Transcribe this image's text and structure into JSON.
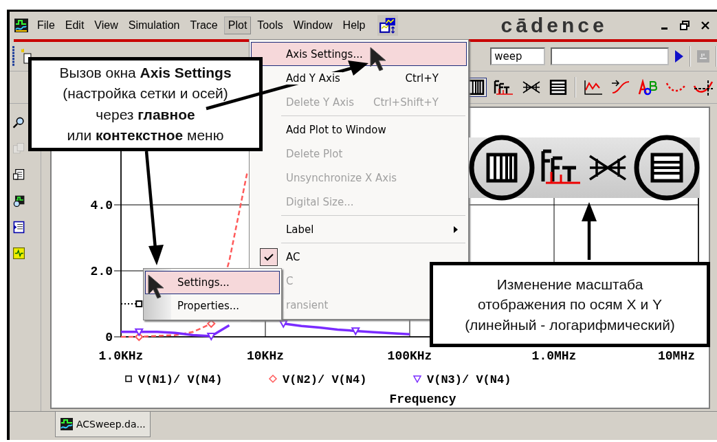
{
  "menu_bar": {
    "items": [
      {
        "label": "File",
        "selected": false
      },
      {
        "label": "Edit",
        "selected": false
      },
      {
        "label": "View",
        "selected": false
      },
      {
        "label": "Simulation",
        "selected": false
      },
      {
        "label": "Trace",
        "selected": false
      },
      {
        "label": "Plot",
        "selected": true
      },
      {
        "label": "Tools",
        "selected": false
      },
      {
        "label": "Window",
        "selected": false
      },
      {
        "label": "Help",
        "selected": false
      }
    ],
    "logo": "cādence"
  },
  "toolbar": {
    "profile_field": "weep"
  },
  "plot_menu": [
    {
      "kind": "item",
      "label": "Axis Settings...",
      "selected": true,
      "disabled": false,
      "checked": false
    },
    {
      "kind": "item",
      "label": "Add Y Axis",
      "shortcut": "Ctrl+Y",
      "selected": false,
      "disabled": false,
      "checked": false
    },
    {
      "kind": "item",
      "label": "Delete Y Axis",
      "shortcut": "Ctrl+Shift+Y",
      "selected": false,
      "disabled": true,
      "checked": false
    },
    {
      "kind": "separator"
    },
    {
      "kind": "item",
      "label": "Add Plot to Window",
      "selected": false,
      "disabled": false,
      "checked": false
    },
    {
      "kind": "item",
      "label": "Delete Plot",
      "selected": false,
      "disabled": true,
      "checked": false
    },
    {
      "kind": "item",
      "label": "Unsynchronize X Axis",
      "selected": false,
      "disabled": true,
      "checked": false
    },
    {
      "kind": "item",
      "label": "Digital Size...",
      "selected": false,
      "disabled": true,
      "checked": false
    },
    {
      "kind": "separator"
    },
    {
      "kind": "submenu",
      "label": "Label",
      "selected": false,
      "disabled": false,
      "checked": false
    },
    {
      "kind": "separator"
    },
    {
      "kind": "item",
      "label": "AC",
      "selected": false,
      "disabled": false,
      "checked": true
    },
    {
      "kind": "item",
      "label": "C",
      "selected": false,
      "disabled": true,
      "checked": false
    },
    {
      "kind": "item",
      "label": "ransient",
      "selected": false,
      "disabled": true,
      "checked": false
    }
  ],
  "context_menu": [
    {
      "label": "Settings...",
      "selected": true
    },
    {
      "label": "Properties...",
      "selected": false
    }
  ],
  "plot": {
    "chart_data": {
      "type": "line",
      "xlabel": "Frequency",
      "categories": [
        "1.0KHz",
        null,
        null,
        null,
        null,
        null,
        null,
        null,
        "10KHz",
        null,
        null,
        null,
        null,
        null,
        null,
        null,
        "100KHz",
        null,
        null,
        null,
        null,
        null,
        null,
        null,
        "1.0MHz",
        null,
        null,
        null,
        null,
        null,
        null,
        null,
        "10MHz"
      ],
      "series": [
        {
          "name": "V(N1)/ V(N4)",
          "color": "#000000",
          "line_style": "dotted",
          "values": [
            1.0,
            1.0,
            null,
            null,
            null,
            null,
            null,
            null,
            null,
            null,
            null,
            null,
            null,
            null,
            null,
            null,
            null,
            null,
            null,
            null,
            null,
            null,
            null,
            null,
            null,
            null,
            null,
            null,
            null,
            null,
            null,
            null,
            null
          ]
        },
        {
          "name": "V(N2)/ V(N4)",
          "color": "#ff5a5a",
          "line_style": "dashed",
          "values": [
            0,
            0,
            0.03,
            0.05,
            0.15,
            0.4,
            2.3,
            5.0,
            null,
            null,
            null,
            null,
            null,
            null,
            null,
            null,
            null,
            null,
            null,
            null,
            null,
            null,
            null,
            null,
            null,
            null,
            null,
            null,
            null,
            null,
            null,
            null,
            null
          ]
        },
        {
          "name": "V(N3)/ V(N4)",
          "color": "#7a2cff",
          "line_style": "solid",
          "values": [
            0.15,
            0.15,
            0.15,
            0.12,
            0.05,
            0.02,
            0.35,
            null,
            null,
            0.4,
            0.33,
            0.28,
            0.22,
            0.18,
            0.14,
            0.11,
            0.08,
            null,
            null,
            null,
            null,
            null,
            null,
            null,
            null,
            null,
            null,
            null,
            null,
            null,
            null,
            null,
            null
          ]
        }
      ],
      "ylim": [
        0,
        6
      ],
      "legend": true,
      "yticks": [
        {
          "value": 0,
          "label": "0"
        },
        {
          "value": 2,
          "label": "2.0"
        },
        {
          "value": 4,
          "label": "4.0"
        }
      ]
    }
  },
  "callouts": [
    {
      "text": "Вызов окна **Axis Settings**\n(настройка сетки и осей)\nчерез **главное**\nили **контекстное** меню"
    },
    {
      "text": "Изменение масштаба\nотображения по осям X и Y\n(линейный - логарифмический)"
    }
  ],
  "tabs": [
    {
      "label": "ACSweep.da...",
      "selected": true
    }
  ]
}
